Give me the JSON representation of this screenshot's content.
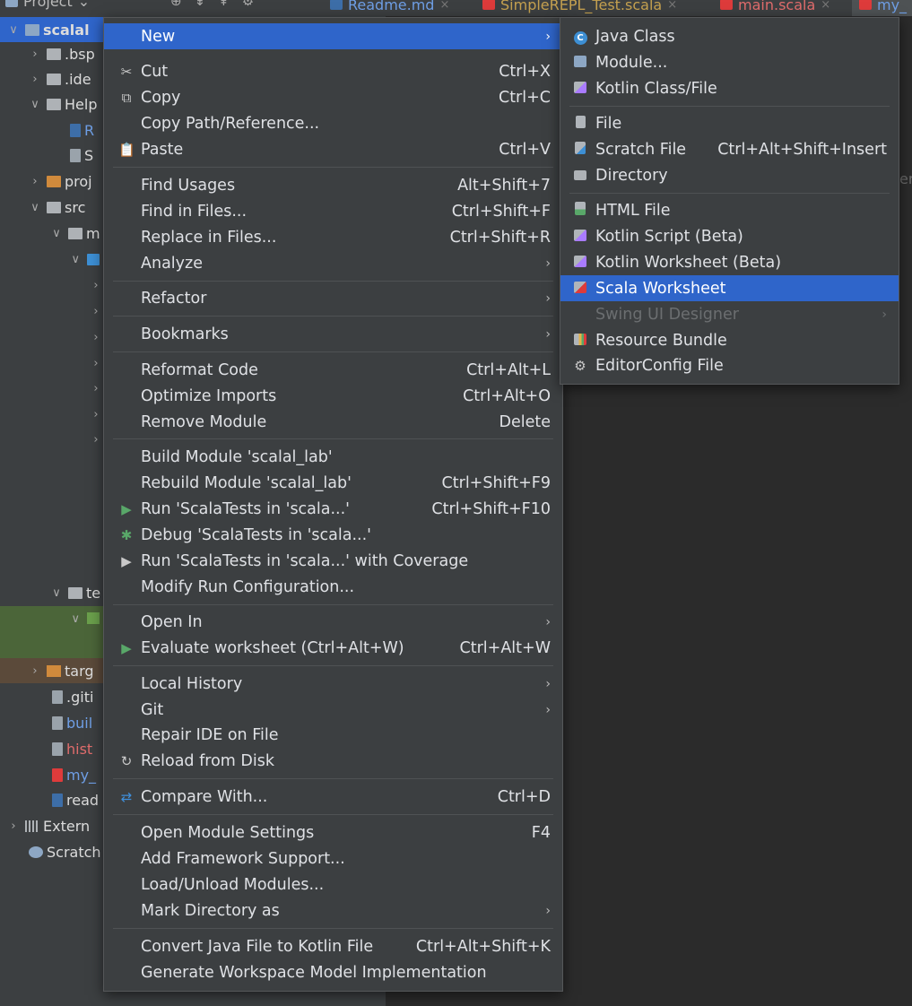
{
  "top_bar": {
    "project_label": "Project",
    "tabs": [
      {
        "label": "Readme.md",
        "badge": "MD"
      },
      {
        "label": "SimpleREPL_Test.scala"
      },
      {
        "label": "main.scala"
      },
      {
        "label": "my_"
      }
    ]
  },
  "tree": {
    "rows": [
      {
        "label": "scalal",
        "arrow": "∨"
      },
      {
        "label": ".bsp",
        "arrow": "›"
      },
      {
        "label": ".ide",
        "arrow": "›"
      },
      {
        "label": "Help",
        "arrow": "∨"
      },
      {
        "label": "R",
        "arrow": ""
      },
      {
        "label": "S",
        "arrow": ""
      },
      {
        "label": "proj",
        "arrow": "›"
      },
      {
        "label": "src",
        "arrow": "∨"
      },
      {
        "label": "m",
        "arrow": "∨"
      },
      {
        "label": "",
        "arrow": "∨"
      },
      {
        "label": "",
        "arrow": "›"
      },
      {
        "label": "",
        "arrow": "›"
      },
      {
        "label": "",
        "arrow": "›"
      },
      {
        "label": "",
        "arrow": "›"
      },
      {
        "label": "",
        "arrow": "›"
      },
      {
        "label": "",
        "arrow": "›"
      },
      {
        "label": "",
        "arrow": "›"
      },
      {
        "label": "te",
        "arrow": "∨"
      },
      {
        "label": "",
        "arrow": "∨"
      },
      {
        "label": "targ",
        "arrow": "›"
      },
      {
        "label": ".giti",
        "arrow": ""
      },
      {
        "label": "buil",
        "arrow": ""
      },
      {
        "label": "hist",
        "arrow": ""
      },
      {
        "label": "my_",
        "arrow": ""
      },
      {
        "label": "read",
        "arrow": ""
      },
      {
        "label": "Extern",
        "arrow": "›"
      },
      {
        "label": "Scratch",
        "arrow": ""
      }
    ]
  },
  "editor_bleed_text": "er",
  "context_menu": {
    "items": [
      {
        "label": "New",
        "shortcut": "",
        "submenu": true,
        "icon": "",
        "selected": true
      },
      {
        "label": "Cut",
        "shortcut": "Ctrl+X",
        "icon": "✂"
      },
      {
        "label": "Copy",
        "shortcut": "Ctrl+C",
        "icon": "⧉"
      },
      {
        "label": "Copy Path/Reference...",
        "shortcut": ""
      },
      {
        "label": "Paste",
        "shortcut": "Ctrl+V",
        "icon": "📋"
      },
      {
        "label": "Find Usages",
        "shortcut": "Alt+Shift+7"
      },
      {
        "label": "Find in Files...",
        "shortcut": "Ctrl+Shift+F"
      },
      {
        "label": "Replace in Files...",
        "shortcut": "Ctrl+Shift+R"
      },
      {
        "label": "Analyze",
        "submenu": true
      },
      {
        "label": "Refactor",
        "submenu": true
      },
      {
        "label": "Bookmarks",
        "submenu": true
      },
      {
        "label": "Reformat Code",
        "shortcut": "Ctrl+Alt+L"
      },
      {
        "label": "Optimize Imports",
        "shortcut": "Ctrl+Alt+O"
      },
      {
        "label": "Remove Module",
        "shortcut": "Delete"
      },
      {
        "label": "Build Module 'scalal_lab'",
        "shortcut": ""
      },
      {
        "label": "Rebuild Module 'scalal_lab'",
        "shortcut": "Ctrl+Shift+F9"
      },
      {
        "label": "Run 'ScalaTests in 'scala...'",
        "shortcut": "Ctrl+Shift+F10",
        "icon": "▶"
      },
      {
        "label": "Debug 'ScalaTests in 'scala...'",
        "shortcut": "",
        "icon": "🐞"
      },
      {
        "label": "Run 'ScalaTests in 'scala...' with Coverage",
        "shortcut": "",
        "icon": "▶"
      },
      {
        "label": "Modify Run Configuration...",
        "shortcut": ""
      },
      {
        "label": "Open In",
        "submenu": true
      },
      {
        "label": "Evaluate worksheet (Ctrl+Alt+W)",
        "shortcut": "Ctrl+Alt+W",
        "icon": "▶"
      },
      {
        "label": "Local History",
        "submenu": true
      },
      {
        "label": "Git",
        "submenu": true
      },
      {
        "label": "Repair IDE on File",
        "shortcut": ""
      },
      {
        "label": "Reload from Disk",
        "shortcut": "",
        "icon": "↻"
      },
      {
        "label": "Compare With...",
        "shortcut": "Ctrl+D",
        "icon": "⇄"
      },
      {
        "label": "Open Module Settings",
        "shortcut": "F4"
      },
      {
        "label": "Add Framework Support...",
        "shortcut": ""
      },
      {
        "label": "Load/Unload Modules...",
        "shortcut": ""
      },
      {
        "label": "Mark Directory as",
        "submenu": true
      },
      {
        "label": "Convert Java File to Kotlin File",
        "shortcut": "Ctrl+Alt+Shift+K"
      },
      {
        "label": "Generate Workspace Model Implementation",
        "shortcut": ""
      }
    ]
  },
  "new_submenu": {
    "items": [
      {
        "label": "Java Class",
        "shortcut": "",
        "icon": "java-class",
        "color": "#3d8fd4"
      },
      {
        "label": "Module...",
        "shortcut": "",
        "icon": "module",
        "color": "#8da7c4"
      },
      {
        "label": "Kotlin Class/File",
        "shortcut": "",
        "icon": "kotlin",
        "color": "#a97bff"
      },
      {
        "label": "File",
        "shortcut": "",
        "icon": "file",
        "color": "#b0b5ba"
      },
      {
        "label": "Scratch File",
        "shortcut": "Ctrl+Alt+Shift+Insert",
        "icon": "scratch",
        "color": "#b0b5ba"
      },
      {
        "label": "Directory",
        "shortcut": "",
        "icon": "directory",
        "color": "#aeb2b6"
      },
      {
        "label": "HTML File",
        "shortcut": "",
        "icon": "html",
        "color": "#59a869"
      },
      {
        "label": "Kotlin Script (Beta)",
        "shortcut": "",
        "icon": "kotlin",
        "color": "#a97bff"
      },
      {
        "label": "Kotlin Worksheet (Beta)",
        "shortcut": "",
        "icon": "kotlin",
        "color": "#a97bff"
      },
      {
        "label": "Scala Worksheet",
        "shortcut": "",
        "icon": "scala",
        "color": "#de3b3b",
        "selected": true
      },
      {
        "label": "Swing UI Designer",
        "shortcut": "",
        "icon": "",
        "disabled": true,
        "submenu": true
      },
      {
        "label": "Resource Bundle",
        "shortcut": "",
        "icon": "bundle",
        "color": "#e6b34a"
      },
      {
        "label": "EditorConfig File",
        "shortcut": "",
        "icon": "gear",
        "color": "#b0b5ba"
      }
    ]
  }
}
